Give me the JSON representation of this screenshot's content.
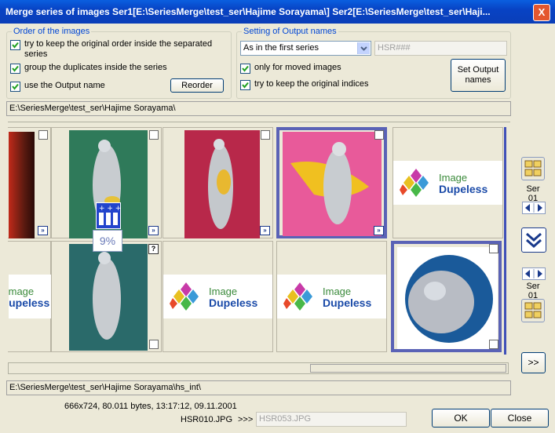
{
  "window": {
    "title": "Merge series of images Ser1[E:\\SeriesMerge\\test_ser\\Hajime Sorayama\\] Ser2[E:\\SeriesMerge\\test_ser\\Haji...",
    "close_label": "X"
  },
  "order_group": {
    "title": "Order of the images",
    "opt_keep_order": "try to keep the original order inside the separated series",
    "opt_keep_order_l1": "try to keep the original order inside the separated",
    "opt_keep_order_l2": "series",
    "opt_group_dupes": "group the duplicates inside the series",
    "opt_use_output": "use the Output name",
    "reorder_label": "Reorder"
  },
  "output_group": {
    "title": "Setting of Output names",
    "mode_selected": "As in the first series",
    "mask_value": "HSR###",
    "opt_only_moved": "only for moved images",
    "opt_keep_indices": "try to keep the original indices",
    "set_button_l1": "Set Output",
    "set_button_l2": "names"
  },
  "path_top": "E:\\SeriesMerge\\test_ser\\Hajime Sorayama\\",
  "path_bottom": "E:\\SeriesMerge\\test_ser\\Hajime Sorayama\\hs_int\\",
  "progress_label": "9%",
  "logo": {
    "line1": "Image",
    "line2": "Dupeless"
  },
  "side": {
    "ser_top": "Ser 01",
    "ser_bottom": "Ser 01",
    "more_label": ">>"
  },
  "status": {
    "info": "666x724, 80.011 bytes, 13:17:12, 09.11.2001",
    "src_name": "HSR010.JPG",
    "arrow": ">>>",
    "dst_name": "HSR053.JPG"
  },
  "buttons": {
    "ok": "OK",
    "close": "Close"
  },
  "colors": {
    "title_bar": "#0843c4",
    "selection": "#5a62b6",
    "group_title": "#0046d5"
  }
}
